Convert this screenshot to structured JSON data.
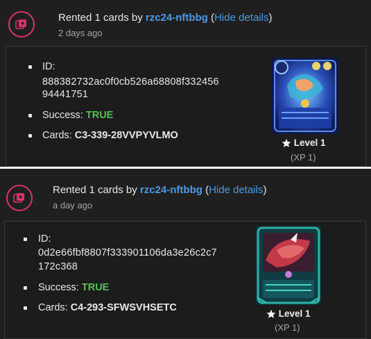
{
  "entries": [
    {
      "prefix": "Rented 1 cards by ",
      "user": "rzc24-nftbbg",
      "paren_open": " (",
      "hide_label": "Hide details",
      "paren_close": ")",
      "time": "2 days ago",
      "id_label": "ID:",
      "id_line1": "888382732ac0f0cb526a68808f332456",
      "id_line2": "94441751",
      "success_label": "Success: ",
      "success_value": "TRUE",
      "cards_label": "Cards: ",
      "cards_value": "C3-339-28VVPYVLMO",
      "level": "Level 1",
      "xp": "(XP 1)",
      "card_icon": "blue-water-monster-card",
      "accent": "#3a6fd8"
    },
    {
      "prefix": "Rented 1 cards by ",
      "user": "rzc24-nftbbg",
      "paren_open": " (",
      "hide_label": "Hide details",
      "paren_close": ")",
      "time": "a day ago",
      "id_label": "ID:",
      "id_line1": "0d2e66fbf8807f333901106da3e26c2c7",
      "id_line2": "172c368",
      "success_label": "Success: ",
      "success_value": "TRUE",
      "cards_label": "Cards: ",
      "cards_value": "C4-293-SFWSVHSETC",
      "level": "Level 1",
      "xp": "(XP 1)",
      "card_icon": "red-dragon-teal-frame-card",
      "accent": "#2fb3a8"
    }
  ],
  "icons": {
    "avatar": "card-rental-icon",
    "star": "star-icon"
  }
}
